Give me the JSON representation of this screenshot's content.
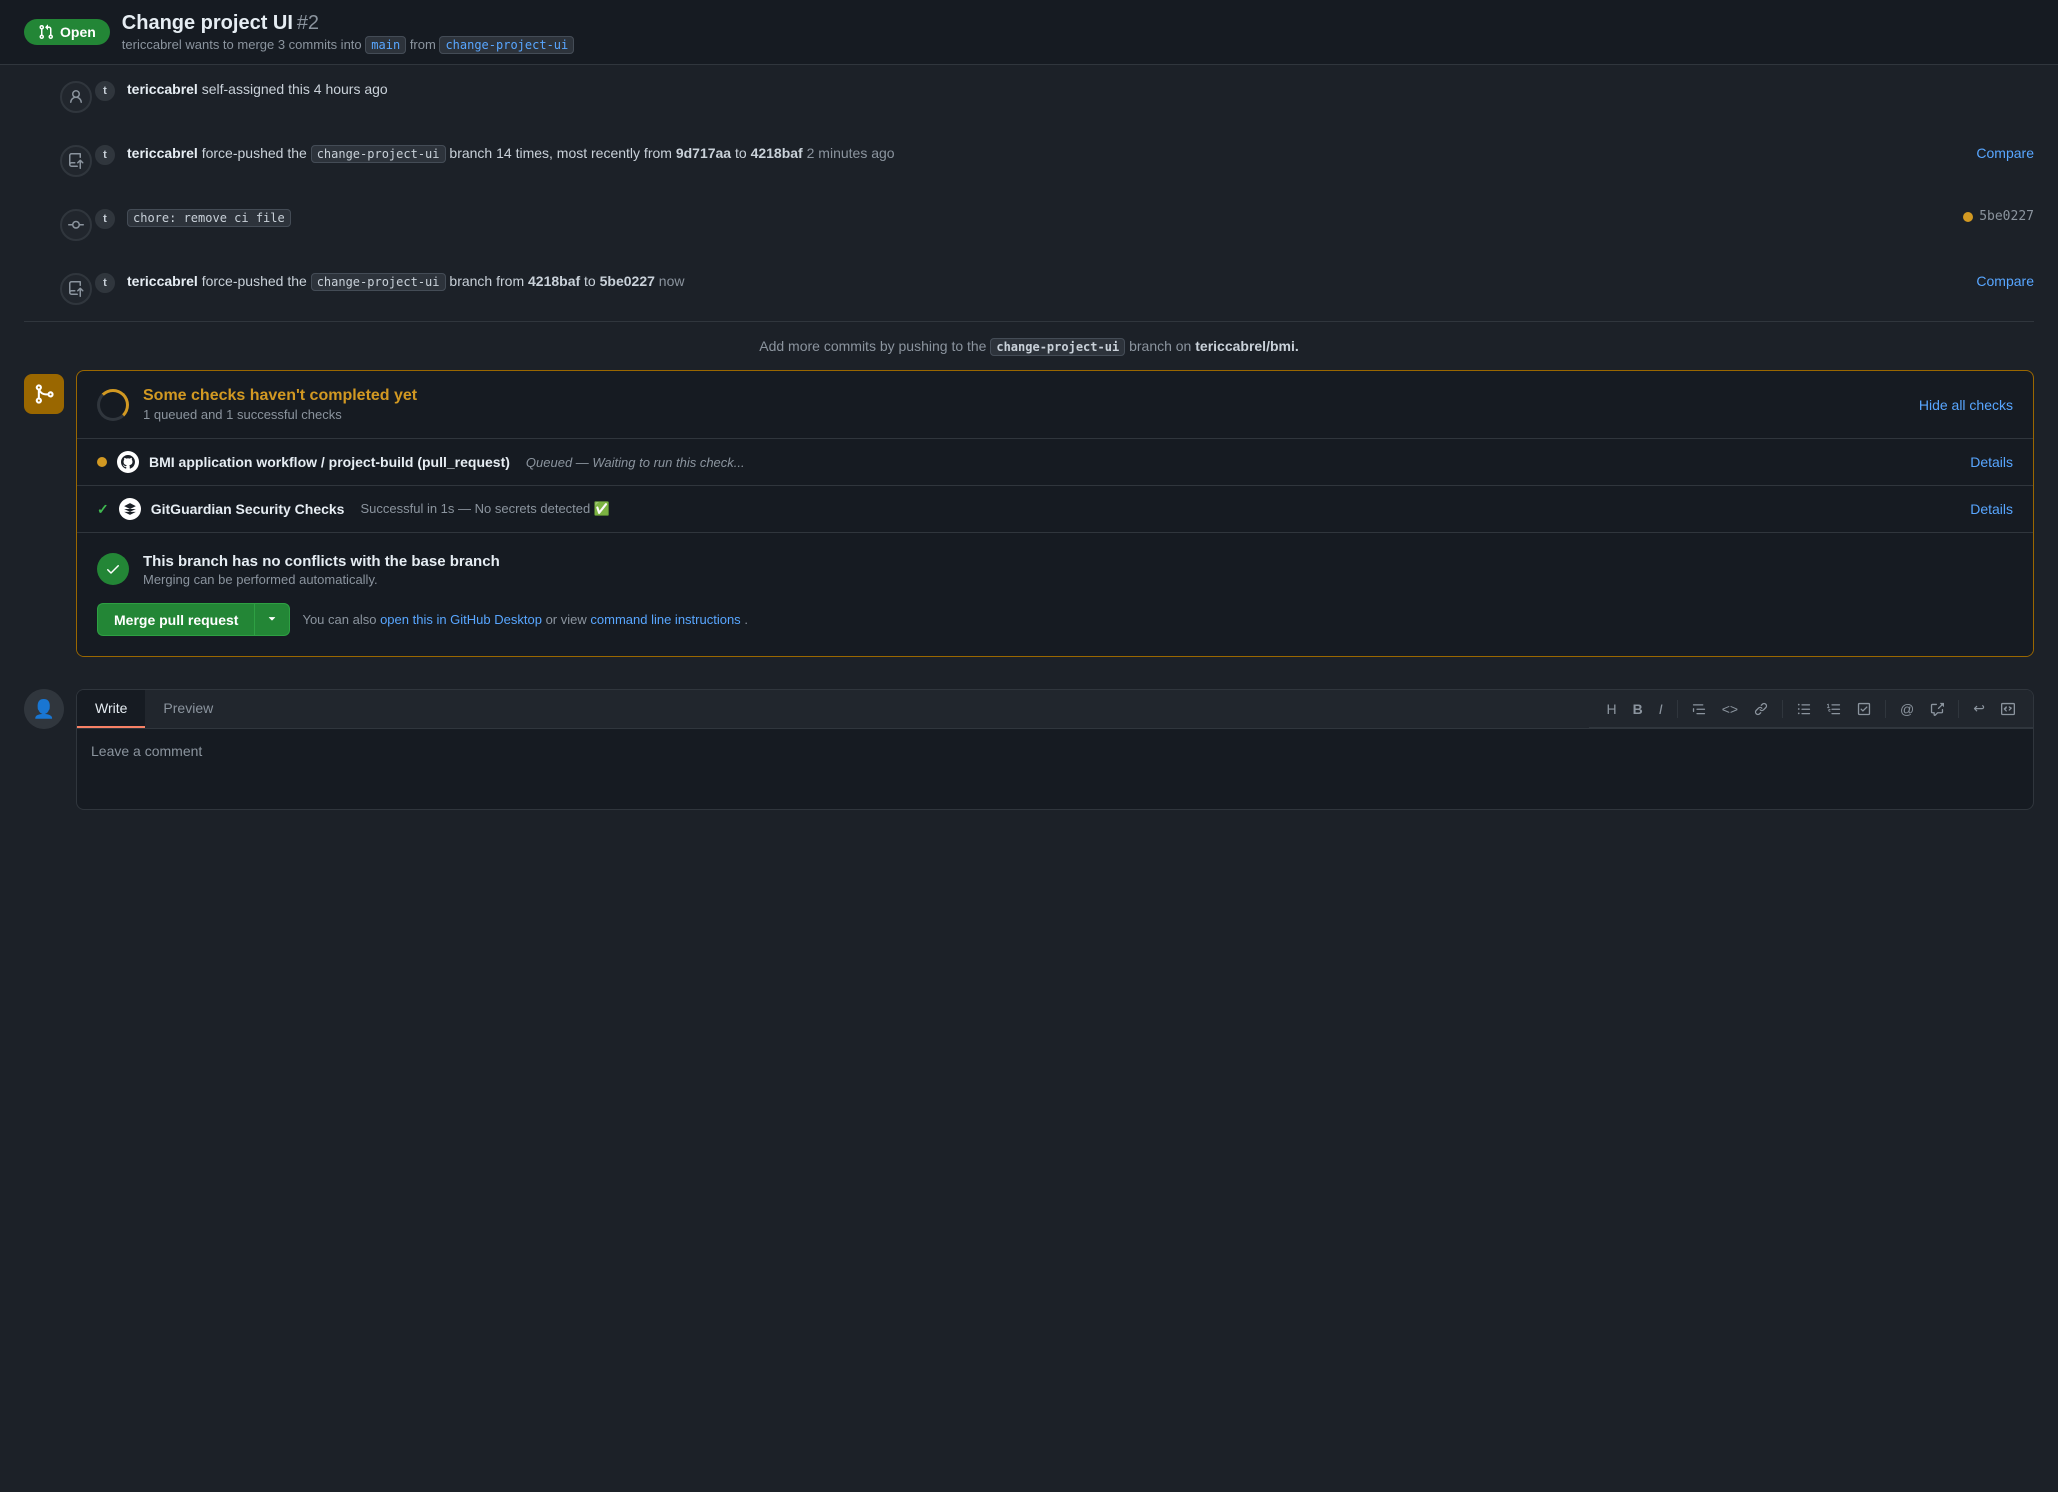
{
  "header": {
    "open_label": "Open",
    "title": "Change project UI",
    "pr_number": "#2",
    "subtitle_pre": "tericcabrel wants to merge 3 commits into",
    "branch_main": "main",
    "branch_from": "from",
    "branch_source": "change-project-ui"
  },
  "timeline": {
    "items": [
      {
        "type": "self-assigned",
        "text": "tericcabrel self-assigned this 4 hours ago"
      },
      {
        "type": "force-push",
        "actor": "tericcabrel",
        "action": " force-pushed the ",
        "branch": "change-project-ui",
        "detail": " branch 14 times, most recently from ",
        "from_hash": "9d717aa",
        "to_text": " to ",
        "to_hash": "4218baf",
        "time": "2 minutes ago",
        "compare": "Compare"
      },
      {
        "type": "commit",
        "message": "chore: remove ci file",
        "hash": "5be0227"
      },
      {
        "type": "force-push",
        "actor": "tericcabrel",
        "action": " force-pushed the ",
        "branch": "change-project-ui",
        "detail": " branch from ",
        "from_hash": "4218baf",
        "to_text": " to ",
        "to_hash": "5be0227",
        "time": "now",
        "compare": "Compare"
      }
    ]
  },
  "push_message": {
    "pre": "Add more commits by pushing to the",
    "branch": "change-project-ui",
    "post": "branch on",
    "repo": "tericcabrel/bmi."
  },
  "checks": {
    "title": "Some checks haven't completed yet",
    "subtitle": "1 queued and 1 successful checks",
    "hide_label": "Hide all checks",
    "items": [
      {
        "status": "queued",
        "name": "BMI application workflow / project-build (pull_request)",
        "desc": "Queued — Waiting to run this check...",
        "details_label": "Details"
      },
      {
        "status": "success",
        "name": "GitGuardian Security Checks",
        "desc": "Successful in 1s — No secrets detected ✅",
        "details_label": "Details"
      }
    ]
  },
  "merge": {
    "title": "This branch has no conflicts with the base branch",
    "subtitle": "Merging can be performed automatically.",
    "button_label": "Merge pull request",
    "info_pre": "You can also",
    "info_link1": "open this in GitHub Desktop",
    "info_mid": "or view",
    "info_link2": "command line instructions",
    "info_post": "."
  },
  "comment": {
    "tab_write": "Write",
    "tab_preview": "Preview",
    "placeholder": "Leave a comment",
    "toolbar": {
      "h": "H",
      "bold": "B",
      "italic": "I",
      "list": "≡",
      "code": "<>",
      "link": "🔗",
      "ul": "☰",
      "ol": "☰",
      "tasklist": "☰",
      "mention": "@",
      "ref": "↗",
      "undo": "↩",
      "no_md": "⊘"
    }
  }
}
